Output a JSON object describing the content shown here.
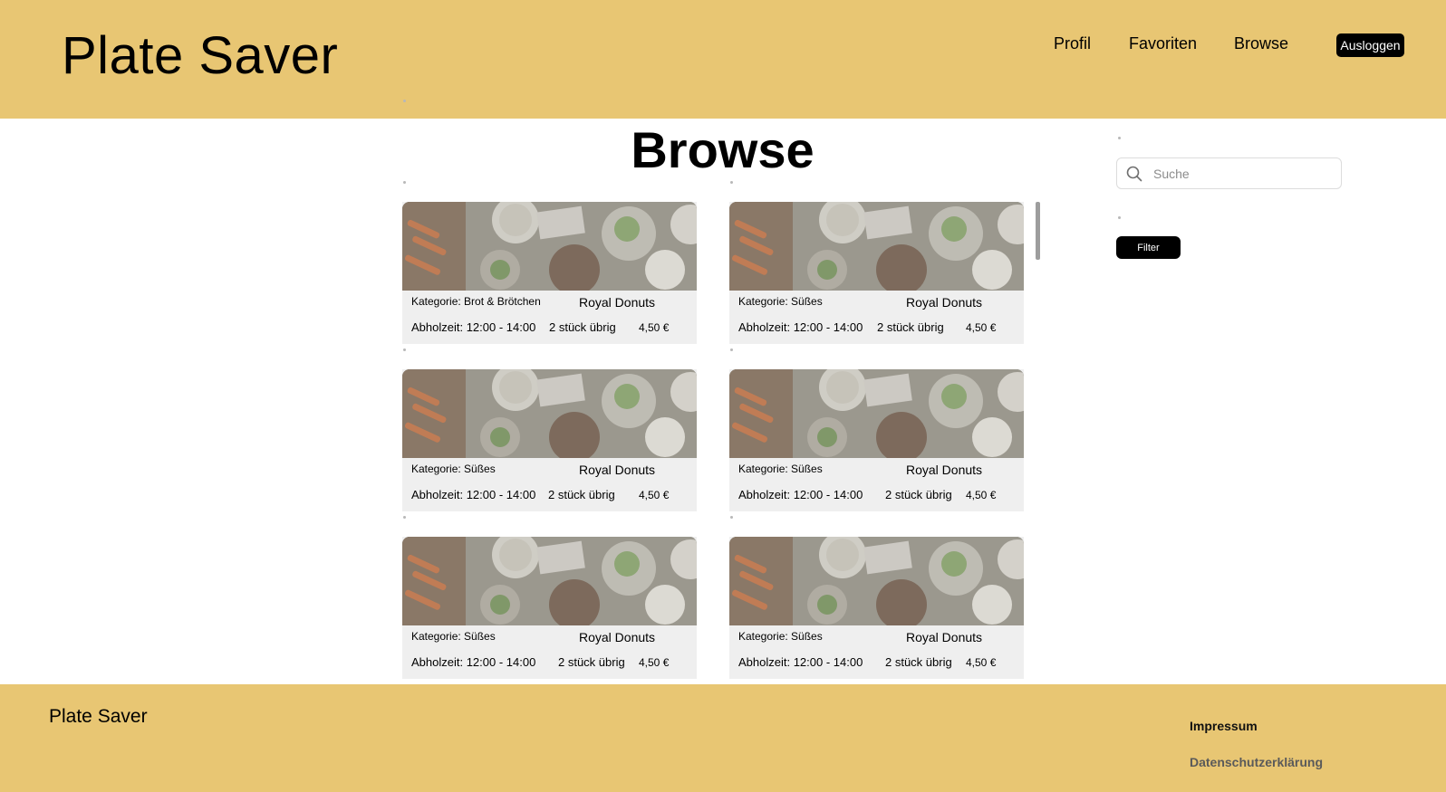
{
  "header": {
    "brand": "Plate Saver",
    "nav": [
      {
        "label": "Profil"
      },
      {
        "label": "Favoriten"
      },
      {
        "label": "Browse"
      }
    ],
    "logout_label": "Ausloggen"
  },
  "main": {
    "title": "Browse"
  },
  "sidebar": {
    "search_placeholder": "Suche",
    "filter_label": "Filter"
  },
  "cards": [
    {
      "category": "Kategorie: Brot & Brötchen",
      "store": "Royal Donuts",
      "pickup": "Abholzeit: 12:00 - 14:00",
      "remaining": "2 stück übrig",
      "price": "4,50 €"
    },
    {
      "category": "Kategorie: Süßes",
      "store": "Royal Donuts",
      "pickup": "Abholzeit: 12:00 - 14:00",
      "remaining": "2 stück übrig",
      "price": "4,50 €"
    },
    {
      "category": "Kategorie: Süßes",
      "store": "Royal Donuts",
      "pickup": "Abholzeit: 12:00 - 14:00",
      "remaining": "2 stück übrig",
      "price": "4,50 €"
    },
    {
      "category": "Kategorie: Süßes",
      "store": "Royal Donuts",
      "pickup": "Abholzeit: 12:00 - 14:00",
      "remaining": "2 stück übrig",
      "price": "4,50 €"
    },
    {
      "category": "Kategorie: Süßes",
      "store": "Royal Donuts",
      "pickup": "Abholzeit: 12:00 - 14:00",
      "remaining": "2 stück übrig",
      "price": "4,50 €"
    },
    {
      "category": "Kategorie: Süßes",
      "store": "Royal Donuts",
      "pickup": "Abholzeit: 12:00 - 14:00",
      "remaining": "2 stück übrig",
      "price": "4,50 €"
    }
  ],
  "footer": {
    "brand": "Plate Saver",
    "impressum": "Impressum",
    "privacy": "Datenschutzerklärung"
  },
  "colors": {
    "header_bg": "#e8c673",
    "card_bg": "#efefef",
    "button_bg": "#000000"
  },
  "icons": {
    "search": "search-icon",
    "card_image": "food-photo"
  }
}
